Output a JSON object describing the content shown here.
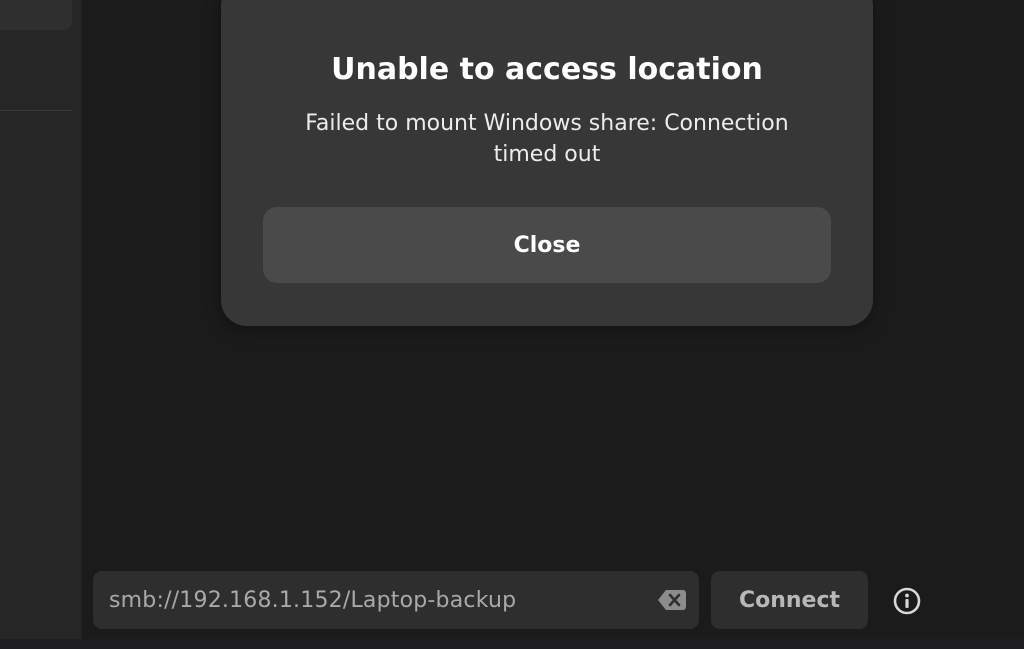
{
  "dialog": {
    "title": "Unable to access location",
    "message": "Failed to mount Windows share: Connection timed out",
    "close_label": "Close"
  },
  "address_bar": {
    "value": "smb://192.168.1.152/Laptop-backup",
    "clear_icon": "edit-clear-icon"
  },
  "connect_label": "Connect",
  "info_icon": "info-icon",
  "colors": {
    "background": "#1b1b1c",
    "sidebar": "#262626",
    "dialog": "#373737",
    "dialog_button": "#4a4a4a",
    "entry": "#2e2e2e"
  }
}
